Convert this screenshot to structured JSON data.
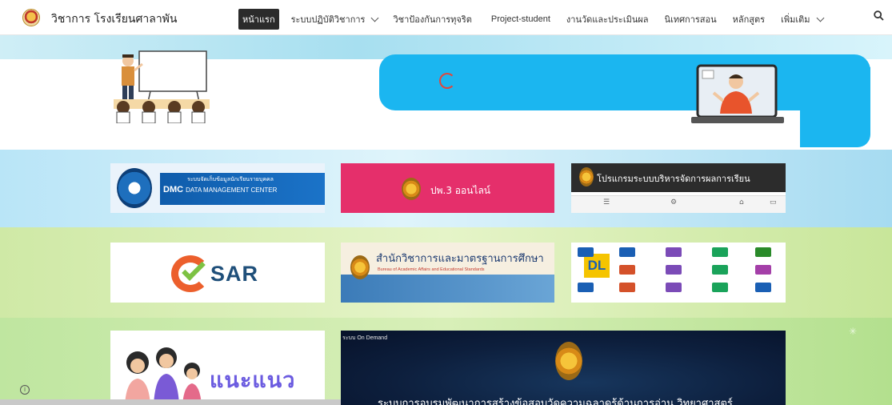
{
  "header": {
    "site_title": "วิชาการ โรงเรียนศาลาพัน",
    "nav": [
      {
        "label": "หน้าแรก",
        "active": true,
        "has_dropdown": false
      },
      {
        "label": "ระบบปฏิบัติวิชาการ",
        "active": false,
        "has_dropdown": true
      },
      {
        "label": "วิชาป้องกันการทุจริต",
        "active": false,
        "has_dropdown": false
      },
      {
        "label": "Project-student",
        "active": false,
        "has_dropdown": false
      },
      {
        "label": "งานวัดและประเมินผล",
        "active": false,
        "has_dropdown": false
      },
      {
        "label": "นิเทศการสอน",
        "active": false,
        "has_dropdown": false
      },
      {
        "label": "หลักสูตร",
        "active": false,
        "has_dropdown": false
      },
      {
        "label": "เพิ่มเติม",
        "active": false,
        "has_dropdown": true
      }
    ],
    "search_icon": "search-icon"
  },
  "banners": {
    "dmc": {
      "title": "ระบบจัดเก็บข้อมูลนักเรียนรายบุคคล",
      "abbr": "DMC",
      "subtitle": "DATA MANAGEMENT CENTER"
    },
    "pw3": {
      "label": "ปพ.3 ออนไลน์"
    },
    "grade": {
      "title": "โปรแกรมระบบบริหารจัดการผลการเรียน"
    },
    "sar": {
      "label": "SAR"
    },
    "bureau": {
      "title": "สำนักวิชาการและมาตรฐานการศึกษา",
      "subtitle": "Bureau of Academic Affairs and Educational Standards"
    },
    "dlit": {
      "big_label": "DL"
    },
    "guide": {
      "label": "แนะแนว"
    },
    "ondemand": {
      "tag": "ระบบ On Demand",
      "title": "ระบบการอบรมพัฒนาการสร้างข้อสอบวัดความฉลาดรู้ด้านการอ่าน วิทยาศาสตร์"
    }
  },
  "colors": {
    "accent_blue": "#1bb6f0",
    "pw3_pink": "#e52f6b",
    "dmc_blue": "#0f5cab"
  }
}
